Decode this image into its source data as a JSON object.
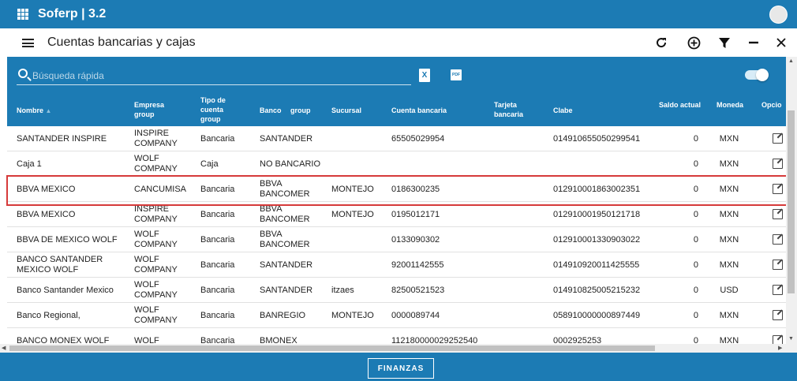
{
  "app": {
    "title": "Soferp | 3.2"
  },
  "window": {
    "title": "Cuentas bancarias y cajas"
  },
  "toolbar": {
    "refresh_icon": "refresh-icon",
    "add_icon": "add-circle-icon",
    "filter_icon": "filter-icon",
    "minimize_icon": "minimize-icon",
    "close_icon": "close-icon"
  },
  "search": {
    "placeholder": "Búsqueda rápida"
  },
  "columns": {
    "nombre": "Nombre",
    "empresa": "Empresa group",
    "tipo": "Tipo de cuenta group",
    "banco": "Banco",
    "banco_group": "group",
    "sucursal": "Sucursal",
    "cuenta": "Cuenta bancaria",
    "tarjeta": "Tarjeta bancaria",
    "clabe": "Clabe",
    "saldo": "Saldo actual",
    "moneda": "Moneda",
    "opciones": "Opcio"
  },
  "rows": [
    {
      "nombre": "SANTANDER INSPIRE",
      "empresa": "INSPIRE COMPANY",
      "tipo": "Bancaria",
      "banco": "SANTANDER",
      "sucursal": "",
      "cuenta": "65505029954",
      "tarjeta": "",
      "clabe": "014910655050299541",
      "saldo": "0",
      "moneda": "MXN"
    },
    {
      "nombre": "Caja 1",
      "empresa": "WOLF COMPANY",
      "tipo": "Caja",
      "banco": "NO BANCARIO",
      "sucursal": "",
      "cuenta": "",
      "tarjeta": "",
      "clabe": "",
      "saldo": "0",
      "moneda": "MXN"
    },
    {
      "nombre": "BBVA MEXICO",
      "empresa": "CANCUMISA",
      "tipo": "Bancaria",
      "banco": "BBVA BANCOMER",
      "sucursal": "MONTEJO",
      "cuenta": "0186300235",
      "tarjeta": "",
      "clabe": "012910001863002351",
      "saldo": "0",
      "moneda": "MXN"
    },
    {
      "nombre": "BBVA MEXICO",
      "empresa": "INSPIRE COMPANY",
      "tipo": "Bancaria",
      "banco": "BBVA BANCOMER",
      "sucursal": "MONTEJO",
      "cuenta": "0195012171",
      "tarjeta": "",
      "clabe": "012910001950121718",
      "saldo": "0",
      "moneda": "MXN"
    },
    {
      "nombre": "BBVA DE MEXICO WOLF",
      "empresa": "WOLF COMPANY",
      "tipo": "Bancaria",
      "banco": "BBVA BANCOMER",
      "sucursal": "",
      "cuenta": "0133090302",
      "tarjeta": "",
      "clabe": "012910001330903022",
      "saldo": "0",
      "moneda": "MXN"
    },
    {
      "nombre": "BANCO SANTANDER MEXICO WOLF",
      "empresa": "WOLF COMPANY",
      "tipo": "Bancaria",
      "banco": "SANTANDER",
      "sucursal": "",
      "cuenta": "92001142555",
      "tarjeta": "",
      "clabe": "014910920011425555",
      "saldo": "0",
      "moneda": "MXN"
    },
    {
      "nombre": "Banco Santander Mexico",
      "empresa": "WOLF COMPANY",
      "tipo": "Bancaria",
      "banco": "SANTANDER",
      "sucursal": "itzaes",
      "cuenta": "82500521523",
      "tarjeta": "",
      "clabe": "014910825005215232",
      "saldo": "0",
      "moneda": "USD"
    },
    {
      "nombre": "Banco Regional,",
      "empresa": "WOLF COMPANY",
      "tipo": "Bancaria",
      "banco": "BANREGIO",
      "sucursal": "MONTEJO",
      "cuenta": "0000089744",
      "tarjeta": "",
      "clabe": "058910000000897449",
      "saldo": "0",
      "moneda": "MXN"
    },
    {
      "nombre": "BANCO MONEX WOLF",
      "empresa": "WOLF",
      "tipo": "Bancaria",
      "banco": "BMONEX",
      "sucursal": "",
      "cuenta": "112180000029252540",
      "tarjeta": "",
      "clabe": "0002925253",
      "saldo": "0",
      "moneda": "MXN"
    }
  ],
  "footer": {
    "button_label": "FINANZAS"
  },
  "colors": {
    "primary": "#1c7bb4",
    "highlight": "#d63a3a"
  }
}
